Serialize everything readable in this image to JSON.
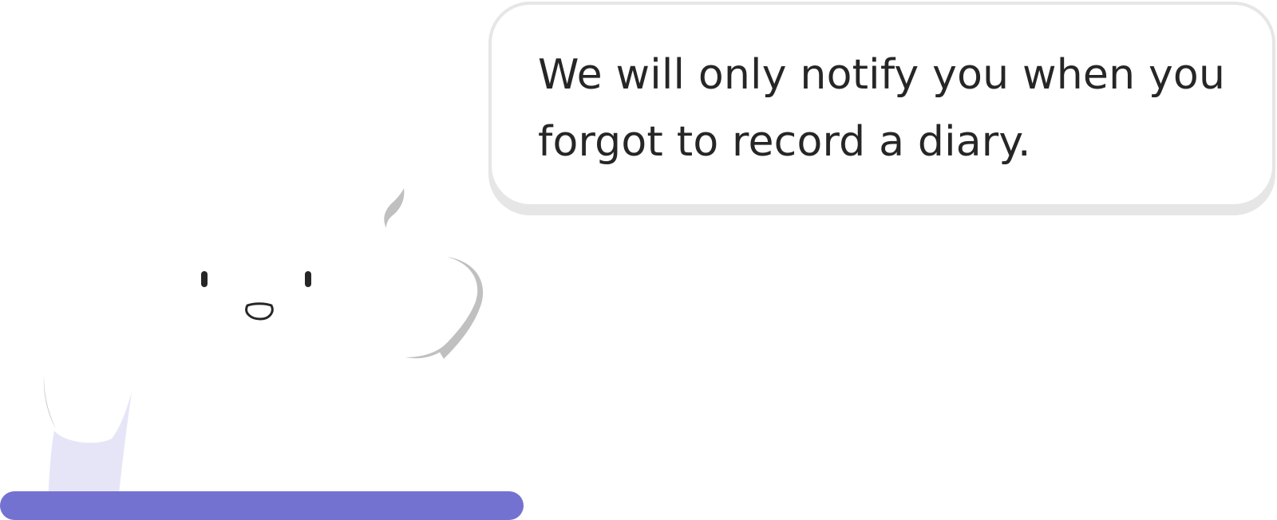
{
  "message": {
    "text": "We will only notify you when you forgot to record a diary."
  },
  "colors": {
    "bubble_border": "#e6e6e6",
    "text": "#262626",
    "accent": "#7472d0",
    "accent_light": "#e6e5f8",
    "shadow": "#c0c0c0",
    "face": "#262626"
  },
  "icons": {
    "mascot": "ghost-mascot-icon"
  }
}
